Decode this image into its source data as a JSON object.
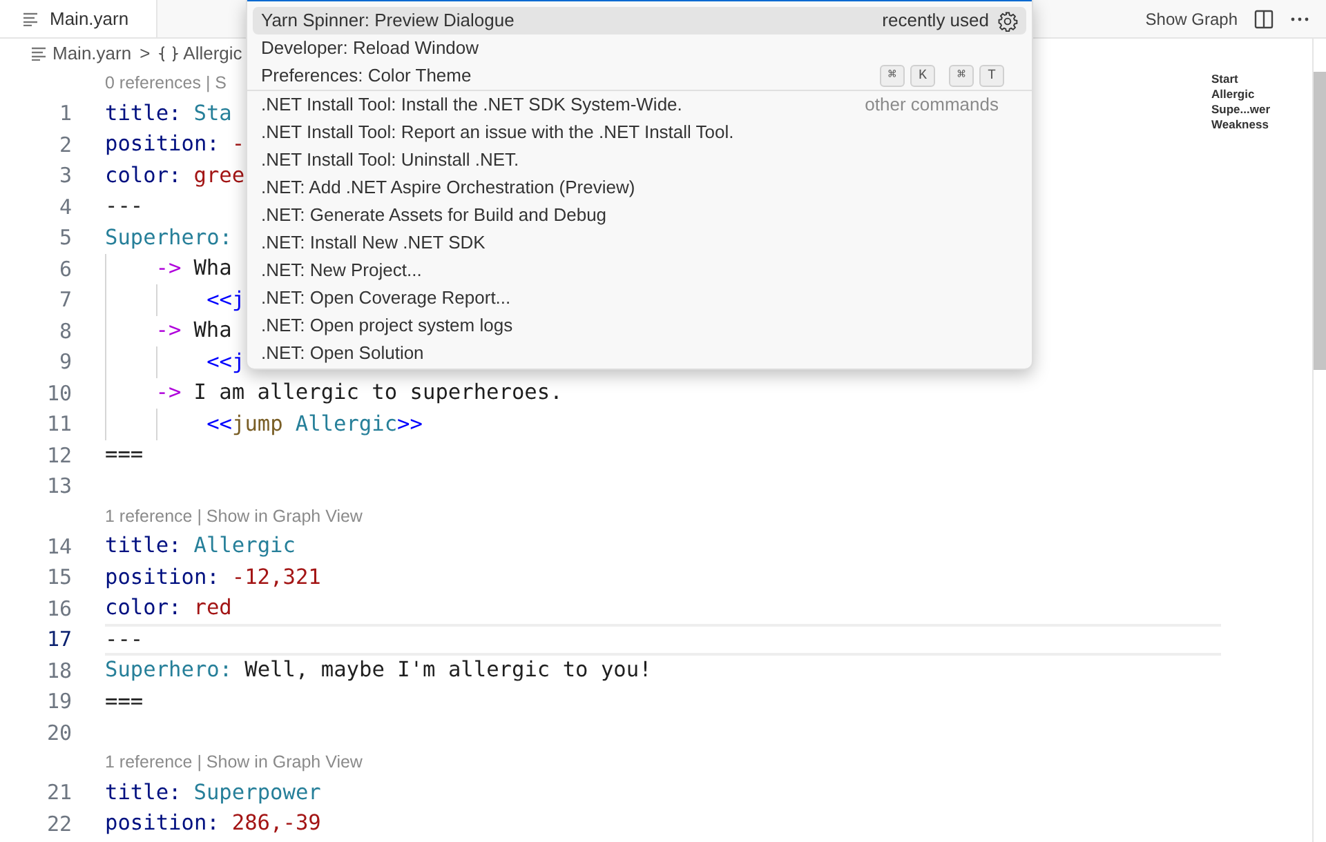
{
  "tabs": [
    {
      "label": "Main.yarn",
      "selected": true
    }
  ],
  "toolbar": {
    "show_graph": "Show Graph"
  },
  "breadcrumb": [
    {
      "label": "Main.yarn",
      "kind": "file"
    },
    {
      "label": "Allergic",
      "kind": "symbol"
    }
  ],
  "breadcrumb_separator": ">",
  "code": [
    {
      "number": "1",
      "lens": "0 references | S",
      "current": false,
      "tokens": [
        {
          "kind": "key",
          "text": "title:"
        },
        {
          "kind": "name",
          "text": "Sta"
        }
      ]
    },
    {
      "number": "2",
      "current": false,
      "tokens": [
        {
          "kind": "key",
          "text": "position:"
        },
        {
          "kind": "literal",
          "text": "-"
        }
      ]
    },
    {
      "number": "3",
      "current": false,
      "tokens": [
        {
          "kind": "key",
          "text": "color:"
        },
        {
          "kind": "literal",
          "text": "gree"
        }
      ]
    },
    {
      "number": "4",
      "current": false,
      "tokens": [
        {
          "kind": "plain",
          "text": "---"
        }
      ]
    },
    {
      "number": "5",
      "current": false,
      "tokens": [
        {
          "kind": "name",
          "text": "Superhero:"
        }
      ],
      "children": [
        {
          "number": "6",
          "current": false,
          "tokens": [
            {
              "kind": "arrow",
              "text": "->"
            },
            {
              "kind": "plain",
              "text": "Wha"
            }
          ],
          "children": [
            {
              "number": "7",
              "current": false,
              "tokens": [
                {
                  "kind": "bracket",
                  "text": "<<j"
                }
              ]
            }
          ]
        },
        {
          "number": "8",
          "current": false,
          "tokens": [
            {
              "kind": "arrow",
              "text": "->"
            },
            {
              "kind": "plain",
              "text": "Wha"
            }
          ],
          "children": [
            {
              "number": "9",
              "current": false,
              "tokens": [
                {
                  "kind": "bracket",
                  "text": "<<j"
                }
              ]
            }
          ]
        },
        {
          "number": "10",
          "current": false,
          "tokens": [
            {
              "kind": "arrow",
              "text": "->"
            },
            {
              "kind": "plain",
              "text": "I am allergic to superheroes."
            }
          ],
          "children": [
            {
              "number": "11",
              "current": false,
              "tokens": [
                {
                  "kind": "bracket",
                  "text": "<<"
                },
                {
                  "kind": "command",
                  "text": "jump"
                },
                {
                  "kind": "name",
                  "text": "Allergic"
                },
                {
                  "kind": "bracket",
                  "text": ">>"
                }
              ]
            }
          ]
        }
      ]
    },
    {
      "number": "12",
      "current": false,
      "tokens": [
        {
          "kind": "plain",
          "text": "==="
        }
      ]
    },
    {
      "number": "13",
      "current": false
    },
    {
      "number": "14",
      "lens": "1 reference | Show in Graph View",
      "current": false,
      "tokens": [
        {
          "kind": "key",
          "text": "title:"
        },
        {
          "kind": "name",
          "text": "Allergic"
        }
      ]
    },
    {
      "number": "15",
      "current": false,
      "tokens": [
        {
          "kind": "key",
          "text": "position:"
        },
        {
          "kind": "literal",
          "text": "-12,321"
        }
      ]
    },
    {
      "number": "16",
      "current": false,
      "tokens": [
        {
          "kind": "key",
          "text": "color:"
        },
        {
          "kind": "literal",
          "text": "red"
        }
      ]
    },
    {
      "number": "17",
      "current": true,
      "tokens": [
        {
          "kind": "plain",
          "text": "---"
        }
      ]
    },
    {
      "number": "18",
      "current": false,
      "tokens": [
        {
          "kind": "name",
          "text": "Superhero:"
        },
        {
          "kind": "plain",
          "text": "Well, maybe I'm allergic to you!"
        }
      ]
    },
    {
      "number": "19",
      "current": false,
      "tokens": [
        {
          "kind": "plain",
          "text": "==="
        }
      ]
    },
    {
      "number": "20",
      "current": false
    },
    {
      "number": "21",
      "lens": "1 reference | Show in Graph View",
      "current": false,
      "tokens": [
        {
          "kind": "key",
          "text": "title:"
        },
        {
          "kind": "name",
          "text": "Superpower"
        }
      ]
    },
    {
      "number": "22",
      "current": false,
      "tokens": [
        {
          "kind": "key",
          "text": "position:"
        },
        {
          "kind": "literal",
          "text": "286,-39"
        }
      ]
    }
  ],
  "minimap": [
    "Start",
    "Allergic",
    "Supe...wer",
    "Weakness"
  ],
  "command_palette": {
    "items": [
      {
        "label": "Yarn Spinner: Preview Dialogue",
        "selected": true,
        "group": "recently used"
      },
      {
        "label": "Developer: Reload Window",
        "selected": false
      },
      {
        "label": "Preferences: Color Theme",
        "selected": false,
        "keys": [
          "⌘",
          "K",
          "⌘",
          "T"
        ]
      },
      {
        "label": ".NET Install Tool: Install the .NET SDK System-Wide.",
        "selected": false,
        "group": "other commands"
      },
      {
        "label": ".NET Install Tool: Report an issue with the .NET Install Tool.",
        "selected": false
      },
      {
        "label": ".NET Install Tool: Uninstall .NET.",
        "selected": false
      },
      {
        "label": ".NET: Add .NET Aspire Orchestration (Preview)",
        "selected": false
      },
      {
        "label": ".NET: Generate Assets for Build and Debug",
        "selected": false
      },
      {
        "label": ".NET: Install New .NET SDK",
        "selected": false
      },
      {
        "label": ".NET: New Project...",
        "selected": false
      },
      {
        "label": ".NET: Open Coverage Report...",
        "selected": false
      },
      {
        "label": ".NET: Open project system logs",
        "selected": false
      },
      {
        "label": ".NET: Open Solution",
        "selected": false
      }
    ]
  }
}
